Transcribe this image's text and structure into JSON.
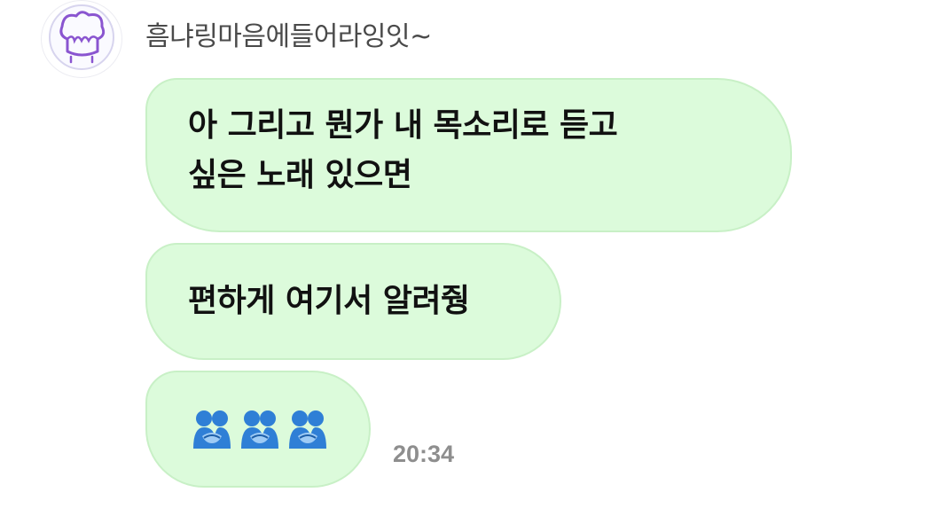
{
  "chat": {
    "sender_name": "흠냐링마음에들어라잉잇~",
    "messages": [
      {
        "lines": [
          "아 그리고 뭔가 내 목소리로 듣고",
          "싶은 노래 있으면"
        ]
      },
      {
        "lines": [
          "편하게 여기서 알려줭"
        ]
      },
      {
        "emojis": [
          "people-hugging-icon",
          "people-hugging-icon",
          "people-hugging-icon"
        ]
      }
    ],
    "timestamp": "20:34"
  },
  "colors": {
    "bubble_bg": "#dcfbdb",
    "bubble_border": "#c8f0c6",
    "sender_text": "#4a4a4a",
    "time_text": "#8e8e8e",
    "avatar_accent": "#8a55d0"
  }
}
